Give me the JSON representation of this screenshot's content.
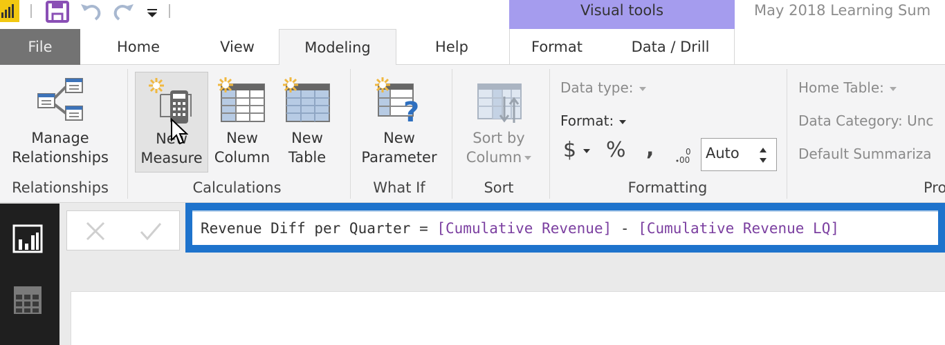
{
  "titlebar": {
    "context_band": "Visual tools",
    "document_title": "May 2018 Learning Sum"
  },
  "tabs": [
    {
      "label": "File"
    },
    {
      "label": "Home"
    },
    {
      "label": "View"
    },
    {
      "label": "Modeling",
      "active": true
    },
    {
      "label": "Help"
    },
    {
      "label": "Format"
    },
    {
      "label": "Data / Drill"
    }
  ],
  "ribbon": {
    "groups": {
      "relationships": {
        "label": "Relationships",
        "buttons": [
          {
            "label_line1": "Manage",
            "label_line2": "Relationships"
          }
        ]
      },
      "calculations": {
        "label": "Calculations",
        "buttons": [
          {
            "label_line1": "New",
            "label_line2": "Measure"
          },
          {
            "label_line1": "New",
            "label_line2": "Column"
          },
          {
            "label_line1": "New",
            "label_line2": "Table"
          }
        ]
      },
      "what_if": {
        "label": "What If",
        "buttons": [
          {
            "label_line1": "New",
            "label_line2": "Parameter"
          }
        ]
      },
      "sort": {
        "label": "Sort",
        "buttons": [
          {
            "label_line1": "Sort by",
            "label_line2": "Column"
          }
        ]
      },
      "formatting": {
        "label": "Formatting",
        "data_type_label": "Data type:",
        "format_label": "Format:",
        "currency_symbol": "$",
        "percent_symbol": "%",
        "comma_symbol": ",",
        "decimals_value": "Auto"
      },
      "properties": {
        "label": "Pro",
        "home_table_label": "Home Table:",
        "data_category_label": "Data Category: Unc",
        "default_summarization_label": "Default Summariza"
      }
    }
  },
  "formula_bar": {
    "measure_name": "Revenue Diff per Quarter",
    "equals": " = ",
    "ref1": "[Cumulative Revenue]",
    "operator": " - ",
    "ref2": "[Cumulative Revenue LQ]"
  },
  "colors": {
    "accent_blue": "#1e73cc",
    "visual_tools": "#a59cee",
    "app_yellow": "#f2c811",
    "measure_ref": "#7b3fa0"
  }
}
